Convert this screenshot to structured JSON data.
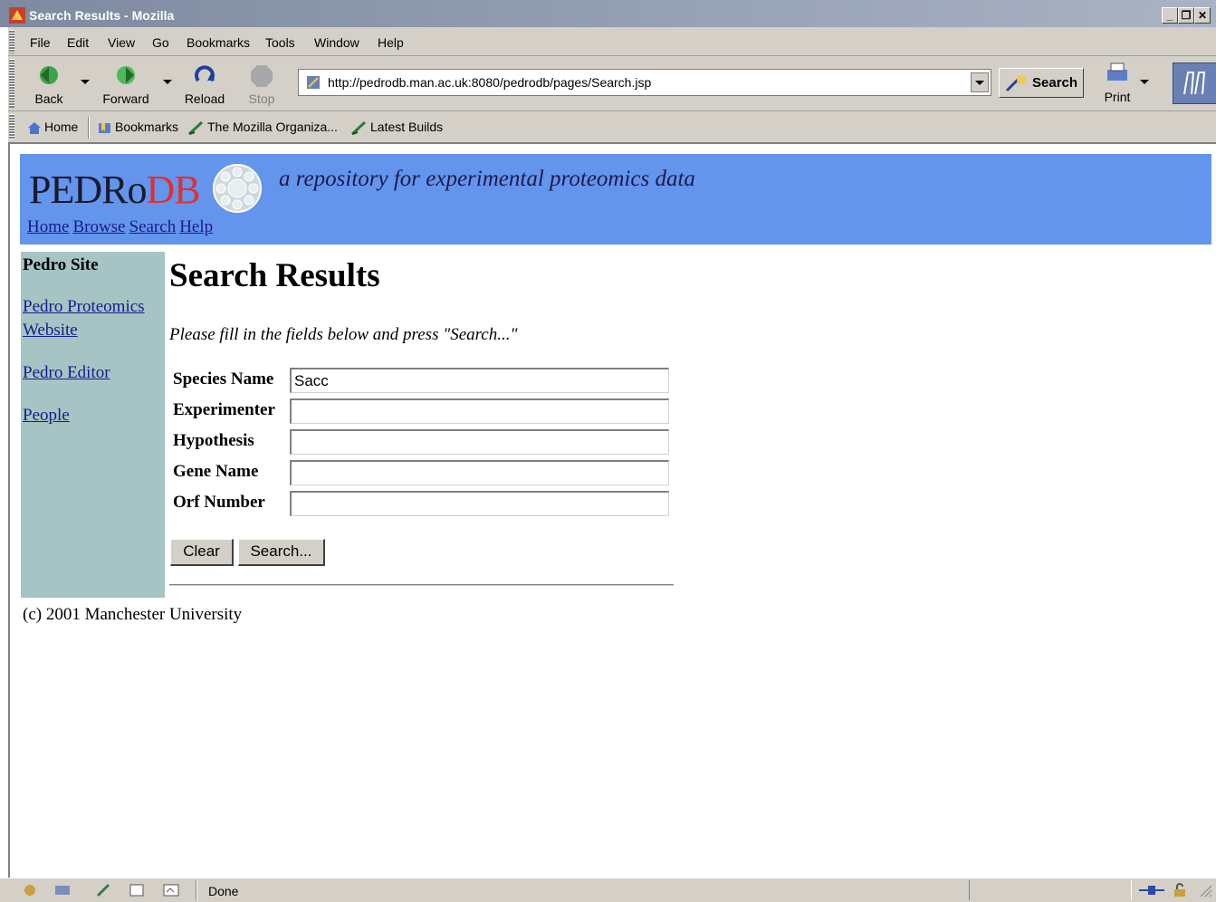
{
  "window": {
    "title": "Search Results - Mozilla"
  },
  "menu": {
    "items": [
      "File",
      "Edit",
      "View",
      "Go",
      "Bookmarks",
      "Tools",
      "Window",
      "Help"
    ]
  },
  "navigation": {
    "back": "Back",
    "forward": "Forward",
    "reload": "Reload",
    "stop": "Stop",
    "url": "http://pedrodb.man.ac.uk:8080/pedrodb/pages/Search.jsp",
    "search": "Search",
    "print": "Print"
  },
  "personal_toolbar": {
    "items": [
      "Home",
      "Bookmarks",
      "The Mozilla Organiza...",
      "Latest Builds"
    ]
  },
  "site": {
    "logo_main": "PEDRo",
    "logo_db": "DB",
    "tagline": "a repository for experimental proteomics data",
    "nav": [
      "Home",
      "Browse",
      "Search",
      "Help"
    ]
  },
  "sidebar": {
    "title": "Pedro Site",
    "links": [
      "Pedro Proteomics",
      "Website",
      "Pedro Editor",
      "People"
    ]
  },
  "main": {
    "heading": "Search Results",
    "instructions": "Please fill in the fields below and press \"Search...\"",
    "fields": [
      {
        "label": "Species Name",
        "value": "Sacc"
      },
      {
        "label": "Experimenter",
        "value": ""
      },
      {
        "label": "Hypothesis",
        "value": ""
      },
      {
        "label": "Gene Name",
        "value": ""
      },
      {
        "label": "Orf Number",
        "value": ""
      }
    ],
    "clear_button": "Clear",
    "search_button": "Search..."
  },
  "footer": {
    "text": "(c) 2001 Manchester University"
  },
  "status": {
    "text": "Done"
  }
}
